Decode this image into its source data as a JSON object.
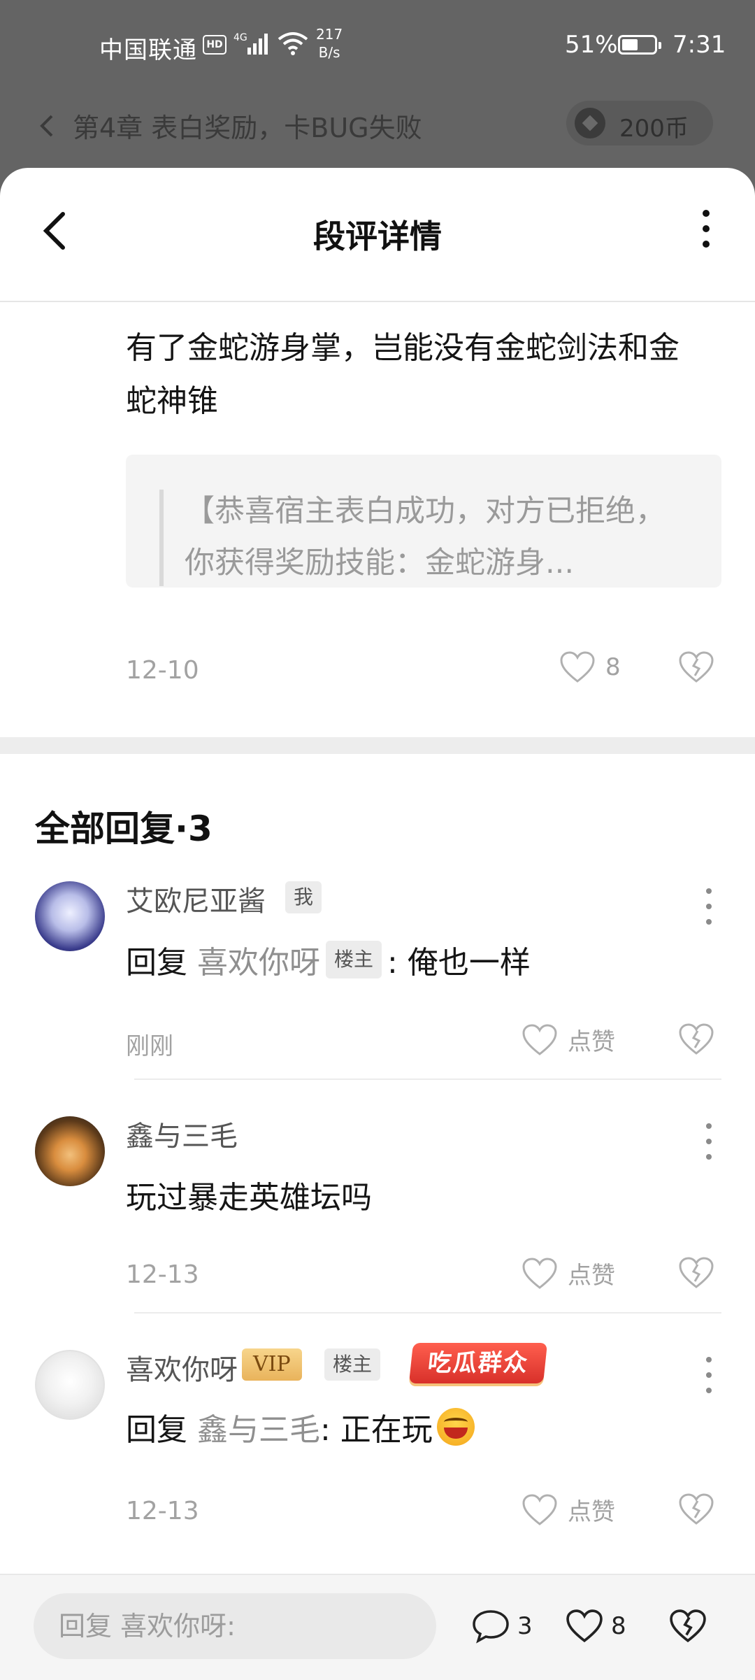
{
  "status_bar": {
    "carrier": "中国联通",
    "hd": "HD",
    "network": "4G",
    "speed_value": "217",
    "speed_unit": "B/s",
    "battery_text": "51%",
    "battery_level": 0.51,
    "time": "7:31"
  },
  "chapter_bar": {
    "title": "第4章 表白奖励，卡BUG失败",
    "coins": "200币"
  },
  "header": {
    "title": "段评详情"
  },
  "post": {
    "text": "有了金蛇游身掌，岂能没有金蛇剑法和金蛇神锥",
    "quote": "【恭喜宿主表白成功，对方已拒绝，你获得奖励技能：金蛇游身...",
    "date": "12-10",
    "likes": "8"
  },
  "replies_section": {
    "title": "全部回复·3"
  },
  "replies": [
    {
      "username": "艾欧尼亚酱",
      "tag": "我",
      "reply_prefix": "回复",
      "reply_to": "喜欢你呀",
      "reply_to_tag": "楼主",
      "text": ": 俺也一样",
      "time": "刚刚",
      "like_label": "点赞"
    },
    {
      "username": "鑫与三毛",
      "text": "玩过暴走英雄坛吗",
      "time": "12-13",
      "like_label": "点赞"
    },
    {
      "username": "喜欢你呀",
      "vip": "VIP",
      "tag": "楼主",
      "fan_badge": "吃瓜群众",
      "reply_prefix": "回复",
      "reply_to": "鑫与三毛",
      "text": ": 正在玩",
      "time": "12-13",
      "like_label": "点赞"
    }
  ],
  "bottom_bar": {
    "placeholder": "回复 喜欢你呀:",
    "comment_count": "3",
    "like_count": "8"
  },
  "colors": {
    "overlay": "#646464",
    "accent_gray": "#a2a2a2",
    "vip_gold": "#e9b35b",
    "badge_red": "#d8302a"
  }
}
